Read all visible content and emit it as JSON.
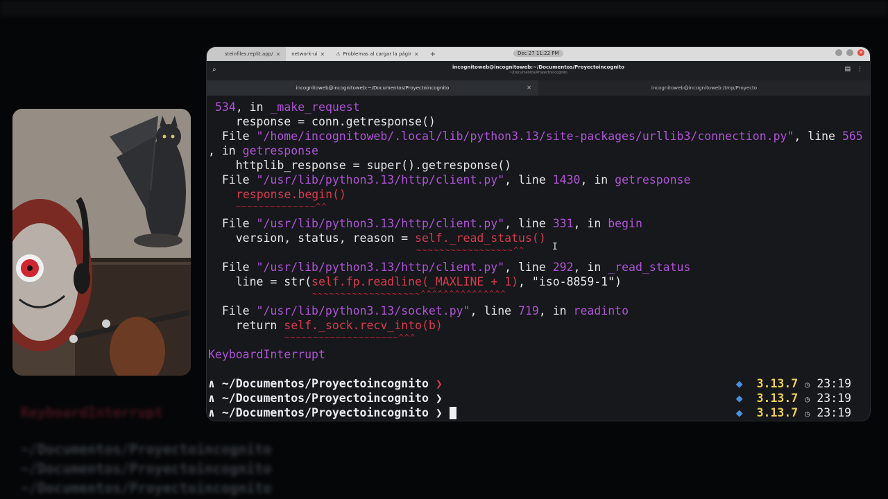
{
  "browser_tabs": [
    {
      "label": "steinfiles.replit.app/"
    },
    {
      "label": "network-ui"
    },
    {
      "label": "Problemas al cargar la págir"
    }
  ],
  "datetime": "Dec 27  11:22 PM",
  "header": {
    "title": "incognitoweb@incognitoweb:~/Documentos/Proyectoincognito",
    "subtitle": "~/Documentos/Proyectoincognito"
  },
  "terminal_tabs": [
    {
      "label": "incognitoweb@incognitoweb:~/Documentos/Proyectoincognito",
      "active": true
    },
    {
      "label": "incognitoweb@incognitoweb:/tmp/Proyecto",
      "active": false
    }
  ],
  "trace": {
    "l1_num": "534",
    "l1_mid": ", in ",
    "l1_fn": "_make_request",
    "l2": "    response = conn.getresponse()",
    "l3_a": "  File ",
    "l3_path": "\"/home/incognitoweb/.local/lib/python3.13/site-packages/urllib3/connection.py\"",
    "l3_b": ", line ",
    "l3_num": "565",
    "l4_a": ", in ",
    "l4_fn": "getresponse",
    "l5": "    httplib_response = super().getresponse()",
    "l6_a": "  File ",
    "l6_path": "\"/usr/lib/python3.13/http/client.py\"",
    "l6_b": ", line ",
    "l6_num": "1430",
    "l6_c": ", in ",
    "l6_fn": "getresponse",
    "l7_code": "response.begin()",
    "l8_u": "~~~~~~~~~~~~~~^^",
    "l9_a": "  File ",
    "l9_path": "\"/usr/lib/python3.13/http/client.py\"",
    "l9_b": ", line ",
    "l9_num": "331",
    "l9_c": ", in ",
    "l9_fn": "begin",
    "l10_a": "    version, status, reason = ",
    "l10_code": "self._read_status()",
    "l11_u": "~~~~~~~~~~~~~~~~~^^",
    "l12_a": "  File ",
    "l12_path": "\"/usr/lib/python3.13/http/client.py\"",
    "l12_b": ", line ",
    "l12_num": "292",
    "l12_c": ", in ",
    "l12_fn": "_read_status",
    "l13_a": "    line = str(",
    "l13_code": "self.fp.readline(_MAXLINE + 1)",
    "l13_b": ", \"iso-8859-1\")",
    "l14_u": "~~~~~~~~~~~~~~~~~~~^^^^^^^^^^^^^^^",
    "l15_a": "  File ",
    "l15_path": "\"/usr/lib/python3.13/socket.py\"",
    "l15_b": ", line ",
    "l15_num": "719",
    "l15_c": ", in ",
    "l15_fn": "readinto",
    "l16_a": "    return ",
    "l16_code": "self._sock.recv_into(b)",
    "l17_u": "~~~~~~~~~~~~~~~~~~~~^^^",
    "kbint": "KeyboardInterrupt"
  },
  "prompts": [
    {
      "arrow": "∧",
      "path": "~/Documentos/Proyectoincognito",
      "chev": "❯",
      "status": "error",
      "python": "3.13.7",
      "time": "23:19"
    },
    {
      "arrow": "∧",
      "path": "~/Documentos/Proyectoincognito",
      "chev": "❯",
      "status": "ok",
      "python": "3.13.7",
      "time": "23:19"
    },
    {
      "arrow": "∧",
      "path": "~/Documentos/Proyectoincognito",
      "chev": "❯",
      "status": "ok",
      "python": "3.13.7",
      "time": "23:19"
    }
  ],
  "icons": {
    "python": "python-dot-icon",
    "clock": "clock-icon"
  },
  "colors": {
    "path_purple": "#b052d8",
    "error_red": "#d93a4e",
    "version_yellow": "#f0d050",
    "python_blue": "#4a90e2"
  }
}
